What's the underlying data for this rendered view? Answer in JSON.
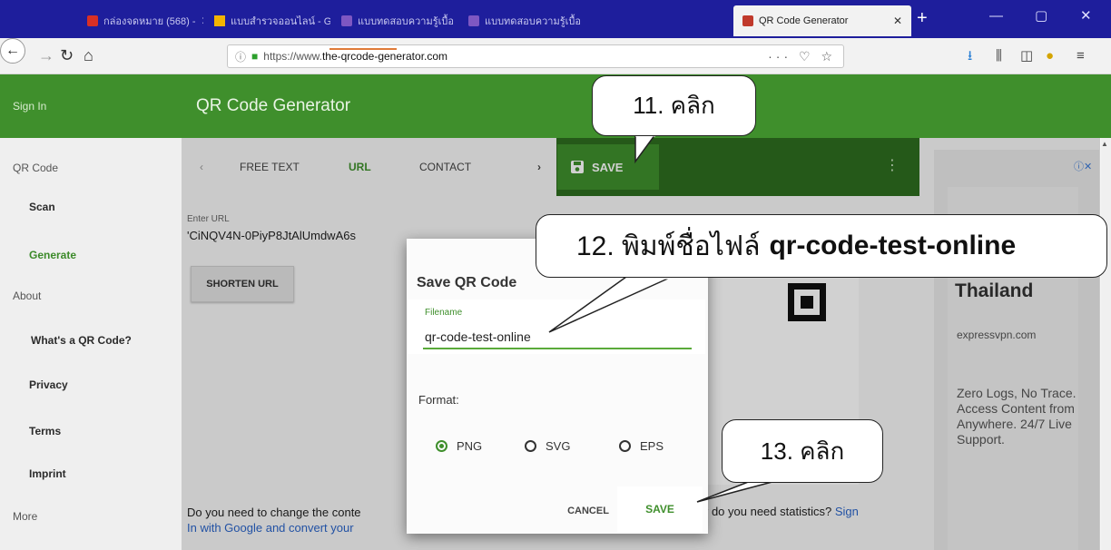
{
  "browser": {
    "tabs": [
      {
        "label": "กล่องจดหมาย (568) - ",
        "icon": "gmail-icon",
        "color": "#d93025"
      },
      {
        "label": "แบบสำรวจออนไลน์ - G",
        "icon": "drive-icon",
        "color": "#f4b400"
      },
      {
        "label": "แบบทดสอบความรู้เบื้อ",
        "icon": "forms-icon",
        "color": "#7e57c2"
      },
      {
        "label": "แบบทดสอบความรู้เบื้อ",
        "icon": "forms-icon",
        "color": "#7e57c2"
      },
      {
        "label": "QR Code Generator",
        "icon": "qr-favicon-icon",
        "color": "#c0392b"
      }
    ],
    "url_prefix": "https://www.",
    "url_domain": "the-qrcode-generator.com"
  },
  "sidebar": {
    "sign_in": "Sign In",
    "items": [
      {
        "label": "QR Code"
      },
      {
        "label": "Scan"
      },
      {
        "label": "Generate"
      },
      {
        "label": "About"
      },
      {
        "label": "What's a QR Code?"
      },
      {
        "label": "Privacy"
      },
      {
        "label": "Terms"
      },
      {
        "label": "Imprint"
      },
      {
        "label": "More"
      }
    ]
  },
  "header": {
    "title": "QR Code Generator"
  },
  "tabs": [
    {
      "label": "FREE TEXT"
    },
    {
      "label": "URL"
    },
    {
      "label": "CONTACT"
    }
  ],
  "main": {
    "enter_url_label": "Enter URL",
    "url_value": "'CiNQV4N-0PiyP8JtAlUmdwA6s",
    "shorten_label": "SHORTEN URL",
    "save_label": "SAVE",
    "footer_prefix": "Do you need to change the conte",
    "footer_link": "In with Google and convert your ",
    "footer_right": "r do you need statistics? ",
    "footer_right_link": "Sign"
  },
  "dialog": {
    "title": "Save QR Code",
    "filename_label": "Filename",
    "filename_value": "qr-code-test-online",
    "format_label": "Format:",
    "formats": [
      {
        "label": "PNG",
        "selected": true
      },
      {
        "label": "SVG",
        "selected": false
      },
      {
        "label": "EPS",
        "selected": false
      }
    ],
    "cancel_label": "CANCEL",
    "save_label": "SAVE"
  },
  "ad": {
    "title": "Thailand",
    "domain": "expressvpn.com",
    "text": "Zero Logs, No Trace. Access Content from Anywhere. 24/7 Live Support."
  },
  "callouts": {
    "step11": "11. คลิก",
    "step12_prefix": "12. พิมพ์ชื่อไฟล์",
    "step12_filename": "qr-code-test-online",
    "step13": "13. คลิก"
  },
  "colors": {
    "brand_green": "#3f8f2c",
    "dark_green": "#2e6d1f",
    "tab_strip": "#1e1e9c",
    "link_blue": "#2a64c8"
  }
}
